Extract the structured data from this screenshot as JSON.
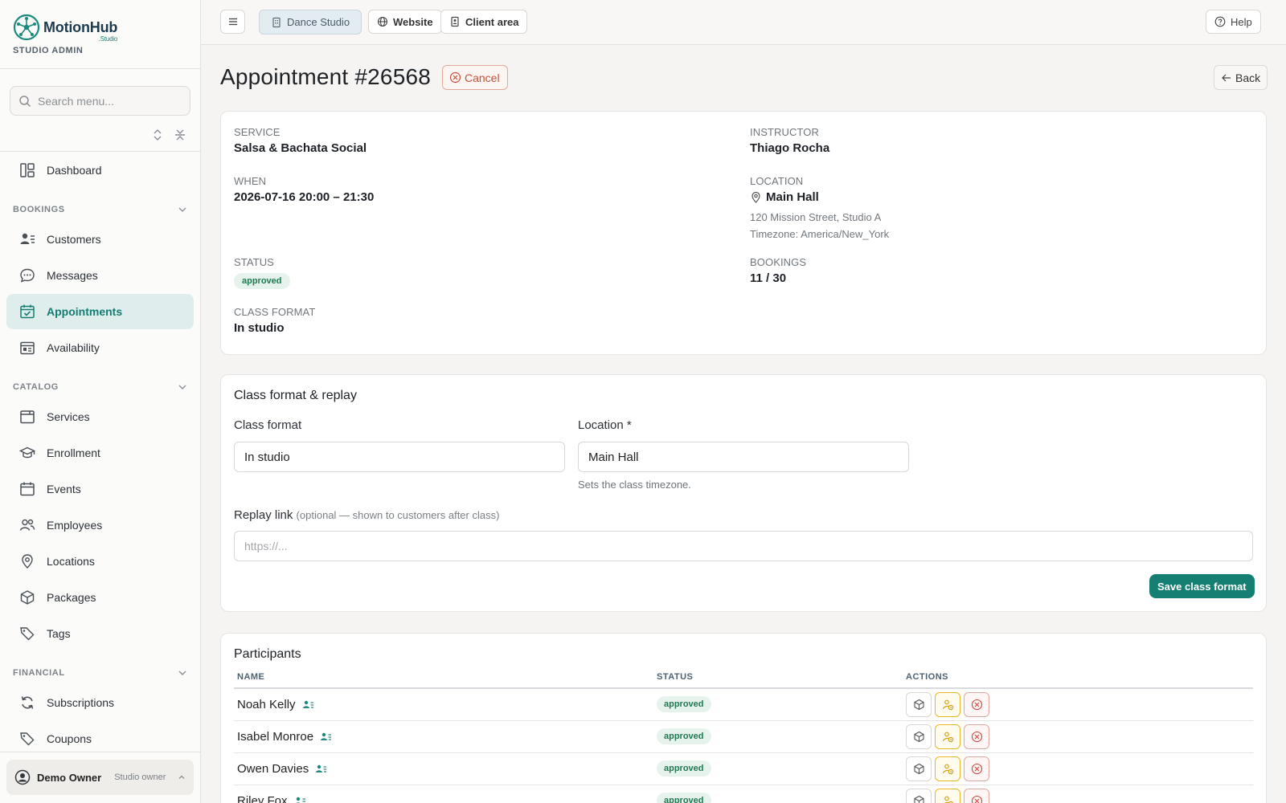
{
  "brand": {
    "name": "MotionHub",
    "sub": ".Studio",
    "role": "STUDIO ADMIN"
  },
  "sidebar": {
    "search_placeholder": "Search menu...",
    "dashboard": "Dashboard",
    "sections": {
      "bookings": "BOOKINGS",
      "catalog": "CATALOG",
      "financial": "FINANCIAL"
    },
    "items": {
      "customers": "Customers",
      "messages": "Messages",
      "appointments": "Appointments",
      "availability": "Availability",
      "services": "Services",
      "enrollment": "Enrollment",
      "events": "Events",
      "employees": "Employees",
      "locations": "Locations",
      "packages": "Packages",
      "tags": "Tags",
      "subscriptions": "Subscriptions",
      "coupons": "Coupons"
    },
    "active": "appointments",
    "user": {
      "name": "Demo Owner",
      "role": "Studio owner"
    }
  },
  "topbar": {
    "studio": "Dance Studio",
    "website": "Website",
    "client_area": "Client area",
    "help": "Help"
  },
  "page": {
    "title": "Appointment #26568",
    "cancel": "Cancel",
    "back": "Back"
  },
  "details": {
    "service_label": "SERVICE",
    "service": "Salsa & Bachata Social",
    "instructor_label": "INSTRUCTOR",
    "instructor": "Thiago Rocha",
    "when_label": "WHEN",
    "when": "2026-07-16 20:00 – 21:30",
    "location_label": "LOCATION",
    "location": "Main Hall",
    "location_address": "120 Mission Street, Studio A",
    "location_timezone": "Timezone: America/New_York",
    "status_label": "STATUS",
    "status": "approved",
    "bookings_label": "BOOKINGS",
    "bookings": "11 / 30",
    "format_label": "CLASS FORMAT",
    "format": "In studio"
  },
  "format_form": {
    "title": "Class format & replay",
    "format_label": "Class format",
    "format_value": "In studio",
    "location_label": "Location *",
    "location_value": "Main Hall",
    "location_help": "Sets the class timezone.",
    "replay_label": "Replay link",
    "replay_hint": "(optional — shown to customers after class)",
    "replay_placeholder": "https://...",
    "save": "Save class format"
  },
  "participants": {
    "title": "Participants",
    "columns": [
      "NAME",
      "STATUS",
      "ACTIONS"
    ],
    "rows": [
      {
        "name": "Noah Kelly",
        "status": "approved"
      },
      {
        "name": "Isabel Monroe",
        "status": "approved"
      },
      {
        "name": "Owen Davies",
        "status": "approved"
      },
      {
        "name": "Riley Fox",
        "status": "approved"
      }
    ]
  },
  "colors": {
    "accent": "#157f73",
    "active_bg": "#dfeeec",
    "danger": "#c2533b",
    "warning": "#e8b624"
  }
}
